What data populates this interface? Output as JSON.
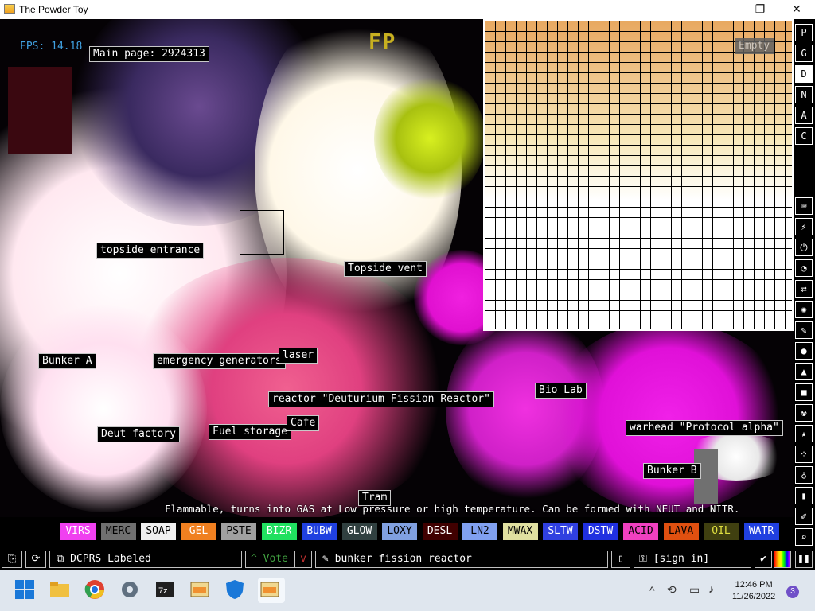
{
  "window": {
    "title": "The Powder Toy",
    "minimize": "—",
    "maximize": "❐",
    "close": "✕"
  },
  "hud": {
    "fps": "FPS: 14.18",
    "fp_indicator": "FP",
    "zoom_label": "Empty",
    "tooltip": "Flammable, turns into GAS at Low pressure or high temperature. Can be formed with NEUT and NITR."
  },
  "signs": [
    {
      "id": "main-page",
      "text": "Main page: 2924313"
    },
    {
      "id": "topside-entrance",
      "text": "topside entrance"
    },
    {
      "id": "topside-vent",
      "text": "Topside vent"
    },
    {
      "id": "bunker-a",
      "text": "Bunker A"
    },
    {
      "id": "emergency-generators",
      "text": "emergency generators"
    },
    {
      "id": "laser",
      "text": "laser"
    },
    {
      "id": "reactor",
      "text": "reactor \"Deuturium Fission Reactor\""
    },
    {
      "id": "bio-lab",
      "text": "Bio Lab"
    },
    {
      "id": "deut-factory",
      "text": "Deut factory"
    },
    {
      "id": "fuel-storage",
      "text": "Fuel storage"
    },
    {
      "id": "cafe",
      "text": "Cafe"
    },
    {
      "id": "warhead",
      "text": "warhead \"Protocol alpha\""
    },
    {
      "id": "bunker-b",
      "text": "Bunker B"
    },
    {
      "id": "tram",
      "text": "Tram"
    }
  ],
  "right_menu": {
    "top": [
      "P",
      "G",
      "D",
      "N",
      "A",
      "C"
    ],
    "selected": "D",
    "categories": [
      "keyboard-icon",
      "plug-icon",
      "power-icon",
      "gauge-icon",
      "arrows-icon",
      "atom-icon",
      "brush-icon",
      "drop-icon",
      "flask-icon",
      "square-icon",
      "radiation-icon",
      "star-icon",
      "dots-icon",
      "bulb-icon",
      "bookmark-icon",
      "pen-icon",
      "search-icon",
      "pause-icon"
    ]
  },
  "elements": [
    {
      "name": "VIRS",
      "bg": "#f040f0",
      "fg": "#ffffff"
    },
    {
      "name": "MERC",
      "bg": "#707070",
      "fg": "#000000"
    },
    {
      "name": "SOAP",
      "bg": "#f0f0f0",
      "fg": "#000000"
    },
    {
      "name": "GEL",
      "bg": "#f08020",
      "fg": "#ffffff"
    },
    {
      "name": "PSTE",
      "bg": "#a0a0a0",
      "fg": "#000000"
    },
    {
      "name": "BIZR",
      "bg": "#20e060",
      "fg": "#ffffff"
    },
    {
      "name": "BUBW",
      "bg": "#2040e0",
      "fg": "#ffffff"
    },
    {
      "name": "GLOW",
      "bg": "#304040",
      "fg": "#ffffff"
    },
    {
      "name": "LOXY",
      "bg": "#80a0e0",
      "fg": "#000000"
    },
    {
      "name": "DESL",
      "bg": "#400000",
      "fg": "#ffffff"
    },
    {
      "name": "LN2",
      "bg": "#80a0f0",
      "fg": "#000000"
    },
    {
      "name": "MWAX",
      "bg": "#e0e0a0",
      "fg": "#000000"
    },
    {
      "name": "SLTW",
      "bg": "#3040e0",
      "fg": "#ffffff"
    },
    {
      "name": "DSTW",
      "bg": "#2030e0",
      "fg": "#ffffff"
    },
    {
      "name": "ACID",
      "bg": "#f040c0",
      "fg": "#000000"
    },
    {
      "name": "LAVA",
      "bg": "#e05010",
      "fg": "#000000"
    },
    {
      "name": "OIL",
      "bg": "#404010",
      "fg": "#e0e040"
    },
    {
      "name": "WATR",
      "bg": "#2040e0",
      "fg": "#ffffff"
    }
  ],
  "bottom_bar": {
    "save_name": "DCPRS Labeled",
    "vote_label": "Vote",
    "tags": "bunker fission reactor",
    "sign_in": "[sign in]"
  },
  "taskbar": {
    "apps": [
      "windows-start-icon",
      "file-explorer-icon",
      "chrome-icon",
      "settings-icon",
      "7zip-icon",
      "powder-toy-taskbar-icon",
      "defender-icon",
      "powder-toy-active-icon"
    ],
    "time": "12:46 PM",
    "date": "11/26/2022",
    "notifications": "3"
  }
}
